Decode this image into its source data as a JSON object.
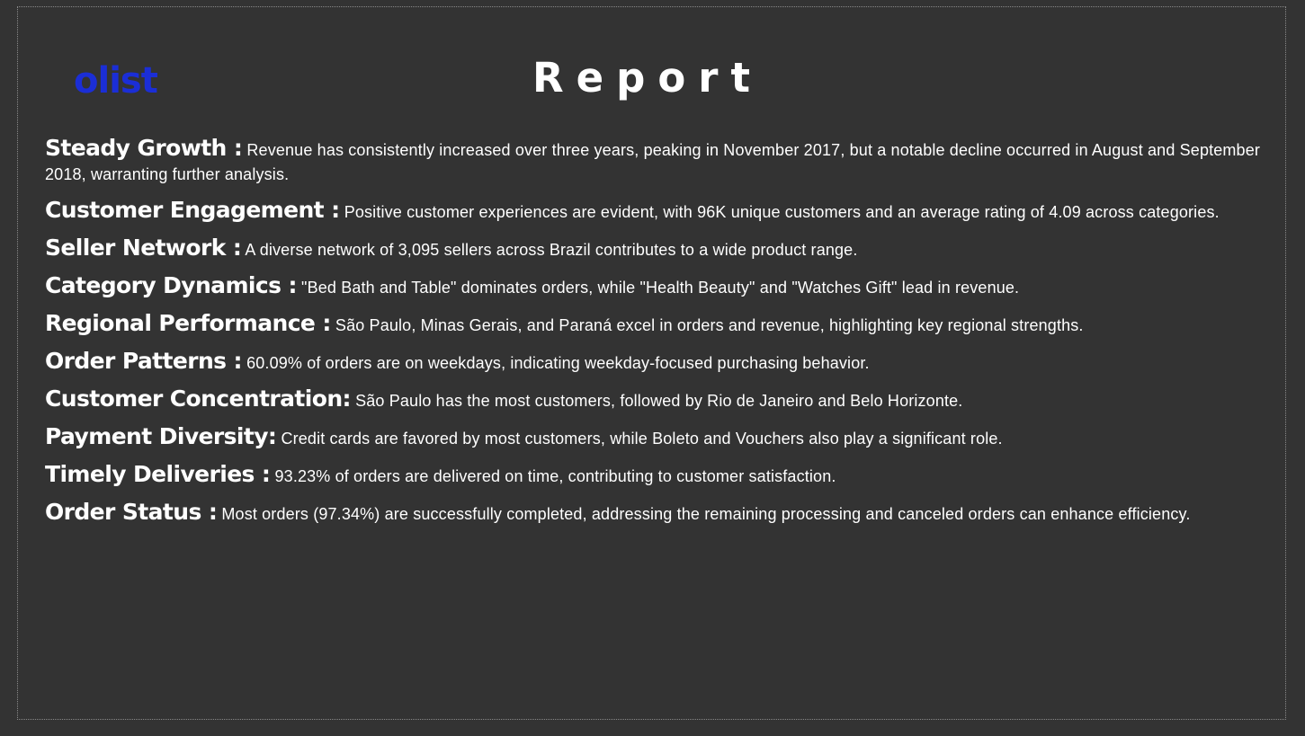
{
  "logo": "olist",
  "title": "Report",
  "items": [
    {
      "heading": "Steady Growth :",
      "text": " Revenue has consistently increased over three years, peaking in November 2017, but a notable decline occurred in August and September 2018, warranting further analysis."
    },
    {
      "heading": "Customer Engagement :",
      "text": " Positive customer experiences are evident, with 96K unique customers and an average rating of 4.09 across categories."
    },
    {
      "heading": "Seller Network :",
      "text": " A diverse network of 3,095 sellers across Brazil contributes to a wide product range."
    },
    {
      "heading": "Category Dynamics :",
      "text": " \"Bed Bath and Table\" dominates orders, while \"Health Beauty\" and \"Watches Gift\" lead in revenue."
    },
    {
      "heading": "Regional Performance :",
      "text": " São Paulo, Minas Gerais, and Paraná excel in orders and revenue, highlighting key regional strengths."
    },
    {
      "heading": "Order Patterns :",
      "text": " 60.09% of orders are on weekdays, indicating weekday-focused purchasing behavior."
    },
    {
      "heading": "Customer Concentration:",
      "text": " São Paulo has the most customers, followed by Rio de Janeiro and Belo Horizonte."
    },
    {
      "heading": "Payment Diversity:",
      "text": " Credit cards are favored by most customers, while Boleto and Vouchers also play a significant role."
    },
    {
      "heading": "Timely Deliveries :",
      "text": " 93.23% of orders are delivered on time, contributing to customer satisfaction."
    },
    {
      "heading": "Order Status :",
      "text": " Most orders (97.34%) are successfully completed, addressing the remaining processing and canceled orders can enhance efficiency."
    }
  ],
  "colors": {
    "background": "#333333",
    "text": "#ffffff",
    "logo": "#1b2ed6",
    "frame_border": "#8a8a8a"
  }
}
